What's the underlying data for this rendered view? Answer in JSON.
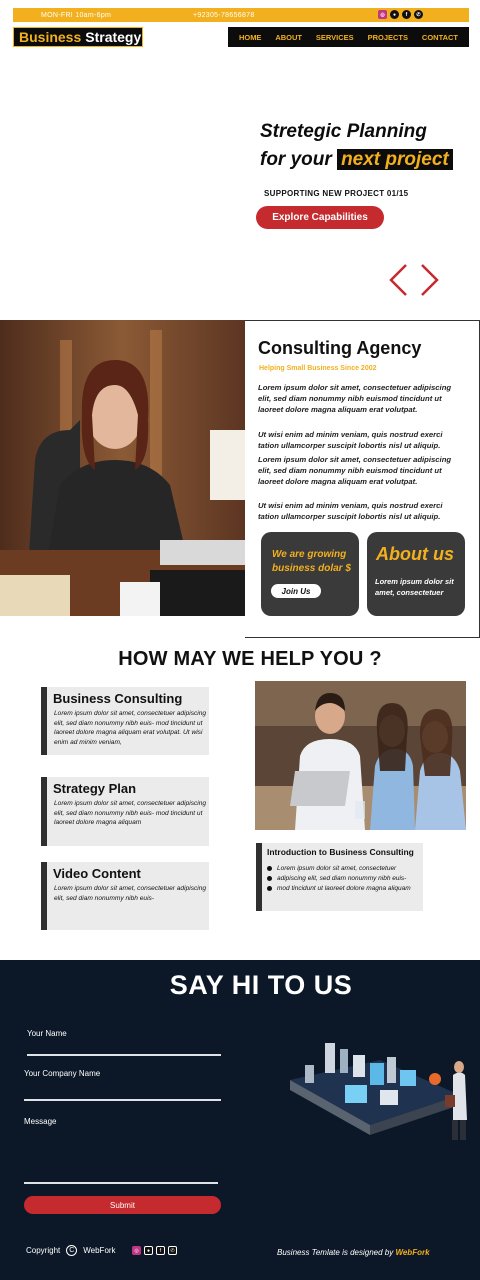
{
  "topbar": {
    "hours": "MON-FRI    10am-6pm",
    "phone": "+92305-78656878",
    "socials": [
      "instagram-icon",
      "github-icon",
      "facebook-icon",
      "whatsapp-icon"
    ]
  },
  "brand": {
    "part1": "Business",
    "part2": "Strategy"
  },
  "nav": [
    "HOME",
    "ABOUT",
    "SERVICES",
    "PROJECTS",
    "CONTACT"
  ],
  "hero": {
    "line1": "Stretegic Planning",
    "line2_prefix": "for your",
    "line2_highlight": "next project",
    "subtitle": "SUPPORTING NEW PROJECT 01/15",
    "cta": "Explore Capabilities"
  },
  "agency": {
    "title": "Consulting Agency",
    "subtitle": "Helping Small Business Since 2002",
    "paragraphs": [
      "Lorem ipsum dolor sit amet, consectetuer adipiscing elit, sed diam nonummy nibh euismod tincidunt ut laoreet dolore magna aliquam erat volutpat.",
      "Ut wisi enim ad minim veniam, quis nostrud exerci tation ullamcorper suscipit lobortis nisl ut aliquip.",
      "Lorem ipsum dolor sit amet, consectetuer adipiscing elit, sed diam nonummy nibh euismod tincidunt ut laoreet dolore magna aliquam erat volutpat.",
      "Ut wisi enim ad minim veniam, quis nostrud exerci tation ullamcorper suscipit lobortis nisl ut aliquip."
    ],
    "growing": "We are growing business dolar $",
    "join": "Join Us",
    "about_title": "About us",
    "about_text": "Lorem ipsum dolor sit amet, consectetuer"
  },
  "help": {
    "title": "HOW MAY WE HELP YOU ?",
    "services": [
      {
        "title": "Business Consulting",
        "text": "Lorem ipsum dolor sit amet, consectetuer adipiscing elit, sed diam nonummy nibh euis- mod tincidunt ut laoreet dolore magna aliquam erat volutpat. Ut wisi enim ad minim veniam,"
      },
      {
        "title": "Strategy Plan",
        "text": "Lorem ipsum dolor sit amet, consectetuer adipiscing elit, sed diam nonummy nibh euis- mod tincidunt ut laoreet dolore magna aliquam"
      },
      {
        "title": "Video Content",
        "text": "Lorem ipsum dolor sit amet, consectetuer adipiscing elit, sed diam nonummy nibh euis-"
      }
    ],
    "intro_title": "Introduction to Business Consulting",
    "intro_items": [
      "Lorem ipsum dolor sit amet, consectetuer",
      "adipiscing elit, sed diam nonummy nibh euis-",
      "mod tincidunt ut laoreet dolore magna aliquam"
    ]
  },
  "contact": {
    "title": "SAY HI TO US",
    "name_label": "Your Name",
    "company_label": "Your Company Name",
    "message_label": "Message",
    "submit": "Submit"
  },
  "footer": {
    "copyright": "Copyright",
    "copy_symbol": "C",
    "brand": "WebFork",
    "credit_prefix": "Business Temlate is designed by",
    "credit_brand": "WebFork"
  },
  "colors": {
    "accent": "#f2b01e",
    "dark": "#0c0c0c",
    "red": "#c52a2e",
    "navy": "#0c1828"
  }
}
